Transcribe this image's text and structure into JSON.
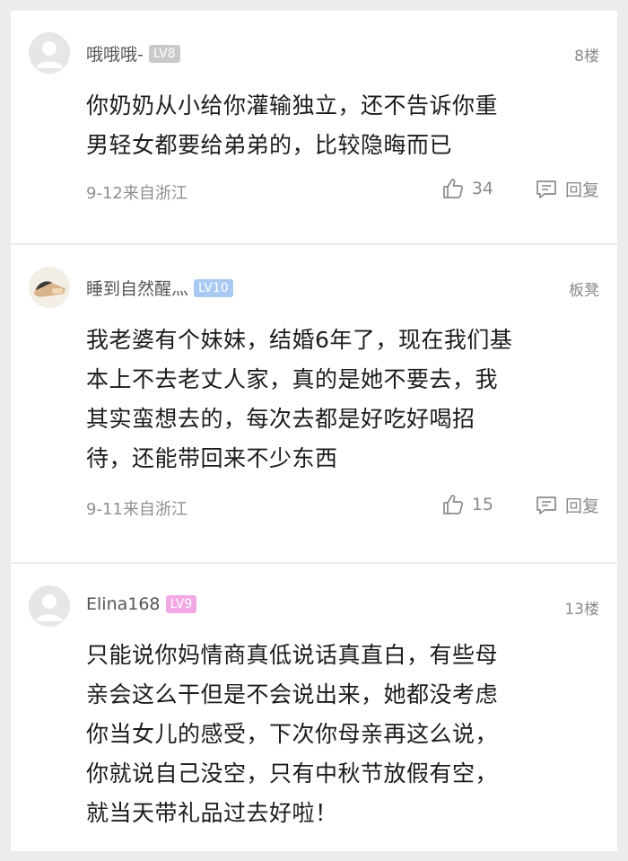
{
  "comments": [
    {
      "username": "哦哦哦-",
      "level": "LV8",
      "floor": "8楼",
      "text_lines": [
        "你奶奶从小给你灌输独立，还不告诉你重",
        "男轻女都要给弟弟的，比较隐晦而已"
      ],
      "time": "9-12来自浙江",
      "likes": "34",
      "reply_label": "回复"
    },
    {
      "username": "睡到自然醒灬",
      "level": "LV10",
      "floor": "板凳",
      "text_lines": [
        "我老婆有个妹妹，结婚6年了，现在我们基",
        "本上不去老丈人家，真的是她不要去，我",
        "其实蛮想去的，每次去都是好吃好喝招",
        "待，还能带回来不少东西"
      ],
      "time": "9-11来自浙江",
      "likes": "15",
      "reply_label": "回复"
    },
    {
      "username": "Elina168",
      "level": "LV9",
      "floor": "13楼",
      "text_lines": [
        "只能说你妈情商真低说话真直白，有些母",
        "亲会这么干但是不会说出来，她都没考虑",
        "你当女儿的感受，下次你母亲再这么说，",
        "你就说自己没空，只有中秋节放假有空，",
        "就当天带礼品过去好啦！"
      ]
    }
  ],
  "colors": {
    "lv8": "#c9c9c9",
    "lv10": "#a9c9f2",
    "lv9": "#f2a9e3"
  }
}
